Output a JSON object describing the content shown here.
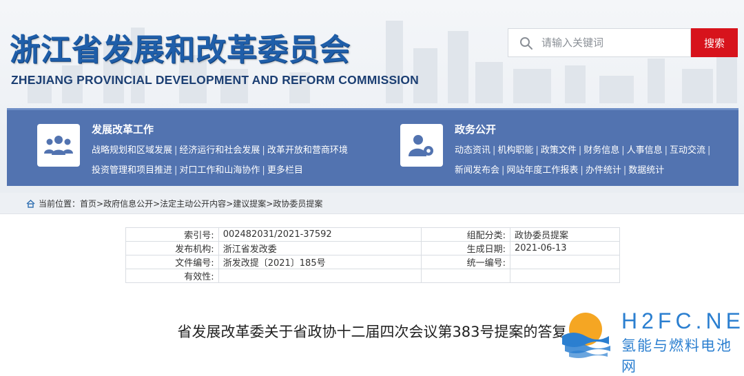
{
  "header": {
    "title_cn": "浙江省发展和改革委员会",
    "title_en": "ZHEJIANG PROVINCIAL DEVELOPMENT AND REFORM COMMISSION"
  },
  "search": {
    "placeholder": "请输入关键词",
    "button_label": "搜索"
  },
  "nav": {
    "left": {
      "title": "发展改革工作",
      "icon": "people-group-icon",
      "line1": [
        "战略规划和区域发展",
        "经济运行和社会发展",
        "改革开放和营商环境"
      ],
      "line2": [
        "投资管理和项目推进",
        "对口工作和山海协作",
        "更多栏目"
      ]
    },
    "right": {
      "title": "政务公开",
      "icon": "user-gear-icon",
      "line1": [
        "动态资讯",
        "机构职能",
        "政策文件",
        "财务信息",
        "人事信息",
        "互动交流"
      ],
      "line2": [
        "新闻发布会",
        "网站年度工作报表",
        "办件统计",
        "数据统计"
      ]
    },
    "separator": "|"
  },
  "breadcrumb": {
    "prefix": "当前位置：",
    "items": [
      "首页",
      "政府信息公开",
      "法定主动公开内容",
      "建议提案",
      "政协委员提案"
    ],
    "separator": ">"
  },
  "meta": {
    "rows": [
      {
        "l1": "索引号:",
        "v1": "002482031/2021-37592",
        "l2": "组配分类:",
        "v2": "政协委员提案"
      },
      {
        "l1": "发布机构:",
        "v1": "浙江省发改委",
        "l2": "生成日期:",
        "v2": "2021-06-13"
      },
      {
        "l1": "文件编号:",
        "v1": "浙发改提〔2021〕185号",
        "l2": "统一编号:",
        "v2": ""
      },
      {
        "l1": "有效性:",
        "v1": "",
        "l2": "",
        "v2": ""
      }
    ]
  },
  "document": {
    "title": "省发展改革委关于省政协十二届四次会议第383号提案的答复"
  },
  "watermark": {
    "text_en": "H2FC.NET",
    "text_cn": "氢能与燃料电池网",
    "icon": "sun-wave-logo-icon"
  },
  "colors": {
    "brand_blue": "#1f5ea9",
    "nav_blue": "#5273b0",
    "search_red": "#d7131c",
    "watermark_blue": "#2b7fd0"
  }
}
